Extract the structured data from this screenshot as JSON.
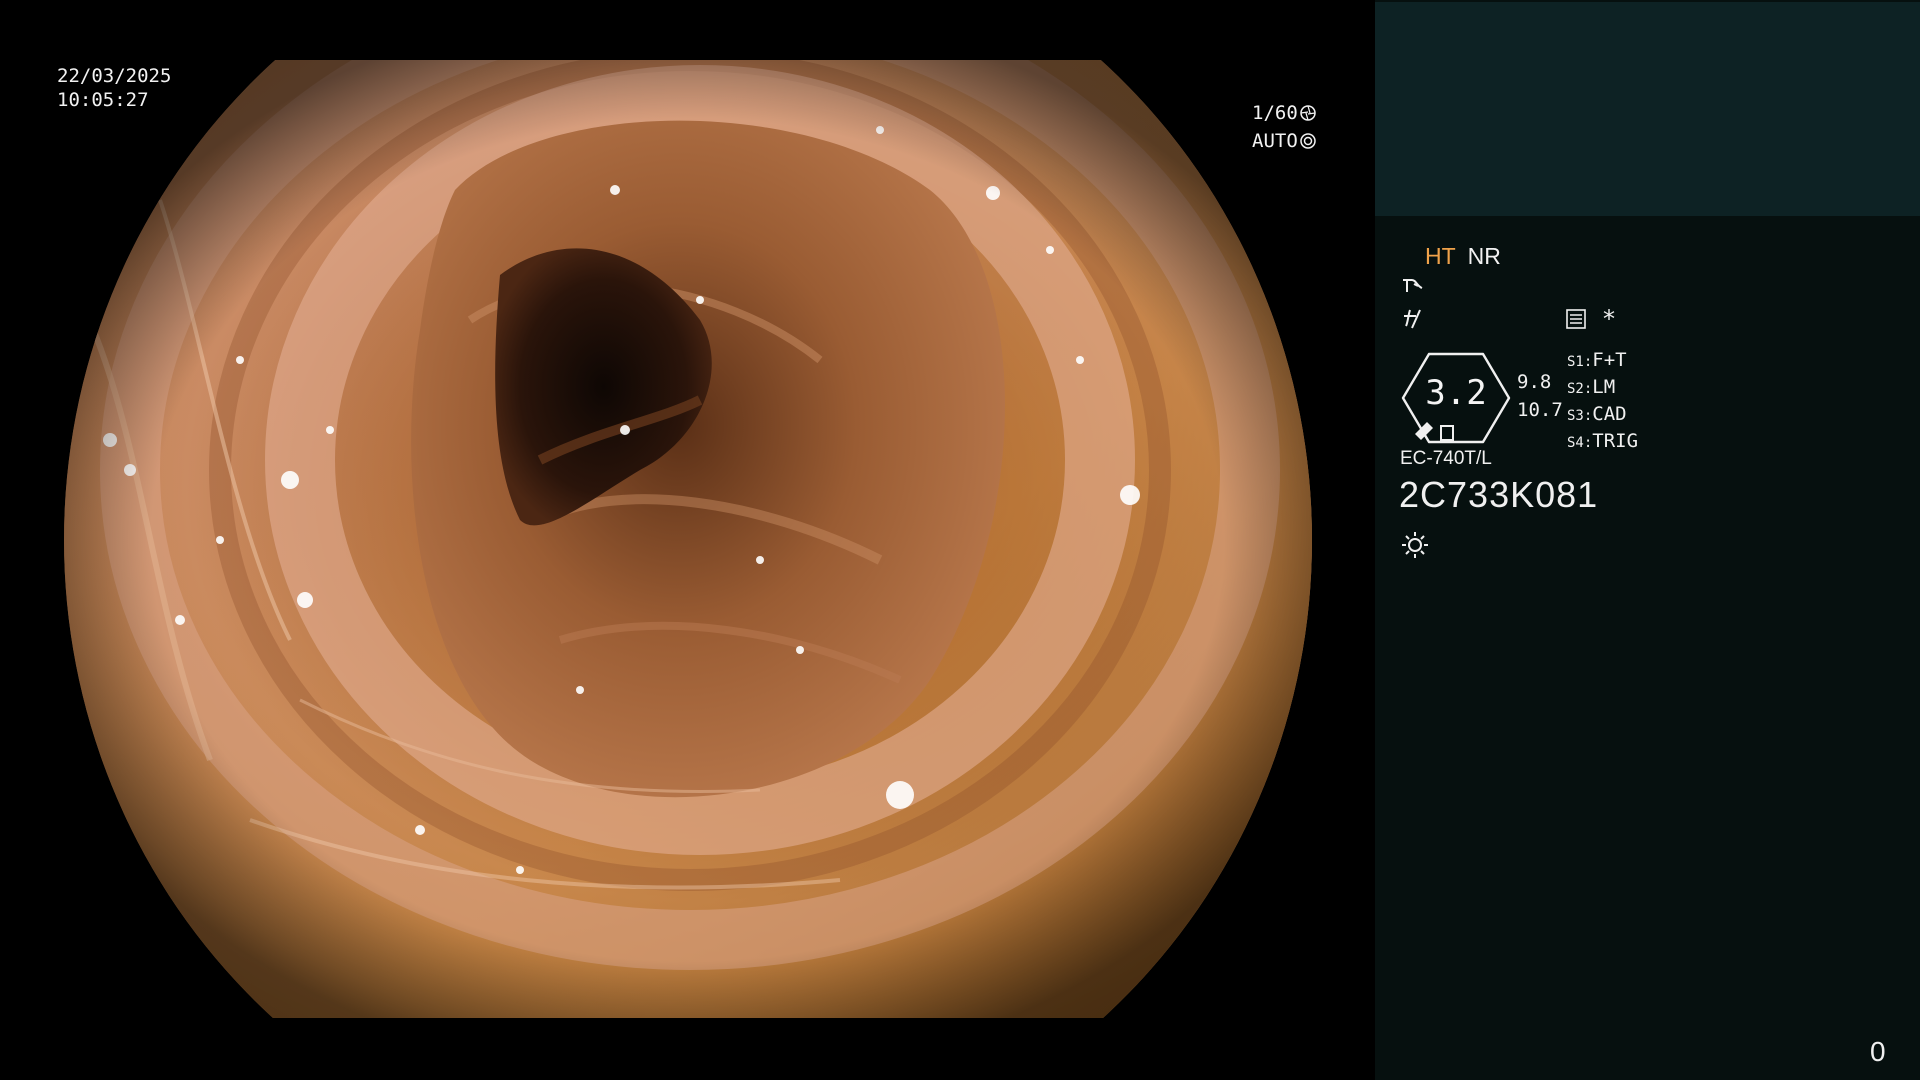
{
  "datetime": {
    "date": "22/03/2025",
    "time": "10:05:27"
  },
  "shutter": {
    "speed": "1/60",
    "speed_icon": "shutter-icon",
    "iris": "AUTO",
    "iris_icon": "iris-icon"
  },
  "processor": {
    "mode_ht": "HT",
    "mode_nr": "NR",
    "structure_icon": "structure-enhance-icon",
    "enhance_icon": "color-enhance-icon",
    "recorder_icon": "recorder-icon",
    "star_label": "*",
    "zoom_value": "3.2",
    "zoom_upper": "9.8",
    "zoom_lower": "10.7",
    "switches": [
      {
        "key": "S1",
        "value": "F+T"
      },
      {
        "key": "S2",
        "value": "LM"
      },
      {
        "key": "S3",
        "value": "CAD"
      },
      {
        "key": "S4",
        "value": "TRIG"
      }
    ],
    "scope_model": "EC-740T/L",
    "scope_serial": "2C733K081",
    "light_icon": "light-source-icon",
    "counter": "0"
  },
  "colors": {
    "panel_top": "#0d2224",
    "panel_bg": "#06100f",
    "ht_accent": "#f0a24a",
    "mucosa": "#c98a5c"
  }
}
